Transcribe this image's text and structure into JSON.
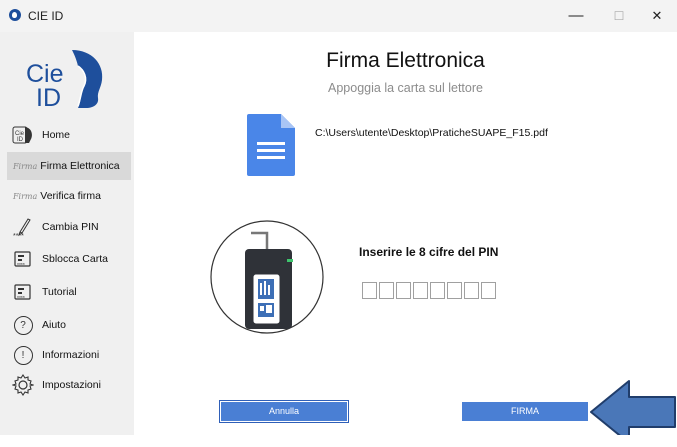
{
  "window": {
    "title": "CIE ID",
    "minimize": "—",
    "maximize": "☐",
    "close": "✕"
  },
  "logo": {
    "line1": "Cie",
    "line2": "ID"
  },
  "sidebar": {
    "items": [
      {
        "label": "Home",
        "icon": "cie-id-icon"
      },
      {
        "label": "Firma Elettronica",
        "icon": "signature-icon",
        "active": true
      },
      {
        "label": "Verifica firma",
        "icon": "signature-icon"
      },
      {
        "label": "Cambia PIN",
        "icon": "pen-pin-icon"
      },
      {
        "label": "Sblocca Carta",
        "icon": "card-unlock-icon"
      },
      {
        "label": "Tutorial",
        "icon": "tutorial-icon"
      },
      {
        "label": "Aiuto",
        "icon": "question-icon"
      },
      {
        "label": "Informazioni",
        "icon": "info-icon"
      },
      {
        "label": "Impostazioni",
        "icon": "gear-icon"
      }
    ],
    "signature_glyph": "Firma",
    "aiuto_glyph": "?",
    "info_glyph": "!"
  },
  "main": {
    "title": "Firma Elettronica",
    "subtitle": "Appoggia la carta sul lettore",
    "file_path": "C:\\Users\\utente\\Desktop\\PraticheSUAPE_F15.pdf",
    "pin_label": "Inserire le 8 cifre del PIN",
    "pin_digits": [
      "",
      "",
      "",
      "",
      "",
      "",
      "",
      ""
    ],
    "cancel_label": "Annulla",
    "sign_label": "FIRMA"
  },
  "colors": {
    "accent": "#4a7fd4",
    "doc_icon": "#4a86e8",
    "arrow": "#4a77b8",
    "sidebar_bg": "#f0f0f0"
  }
}
